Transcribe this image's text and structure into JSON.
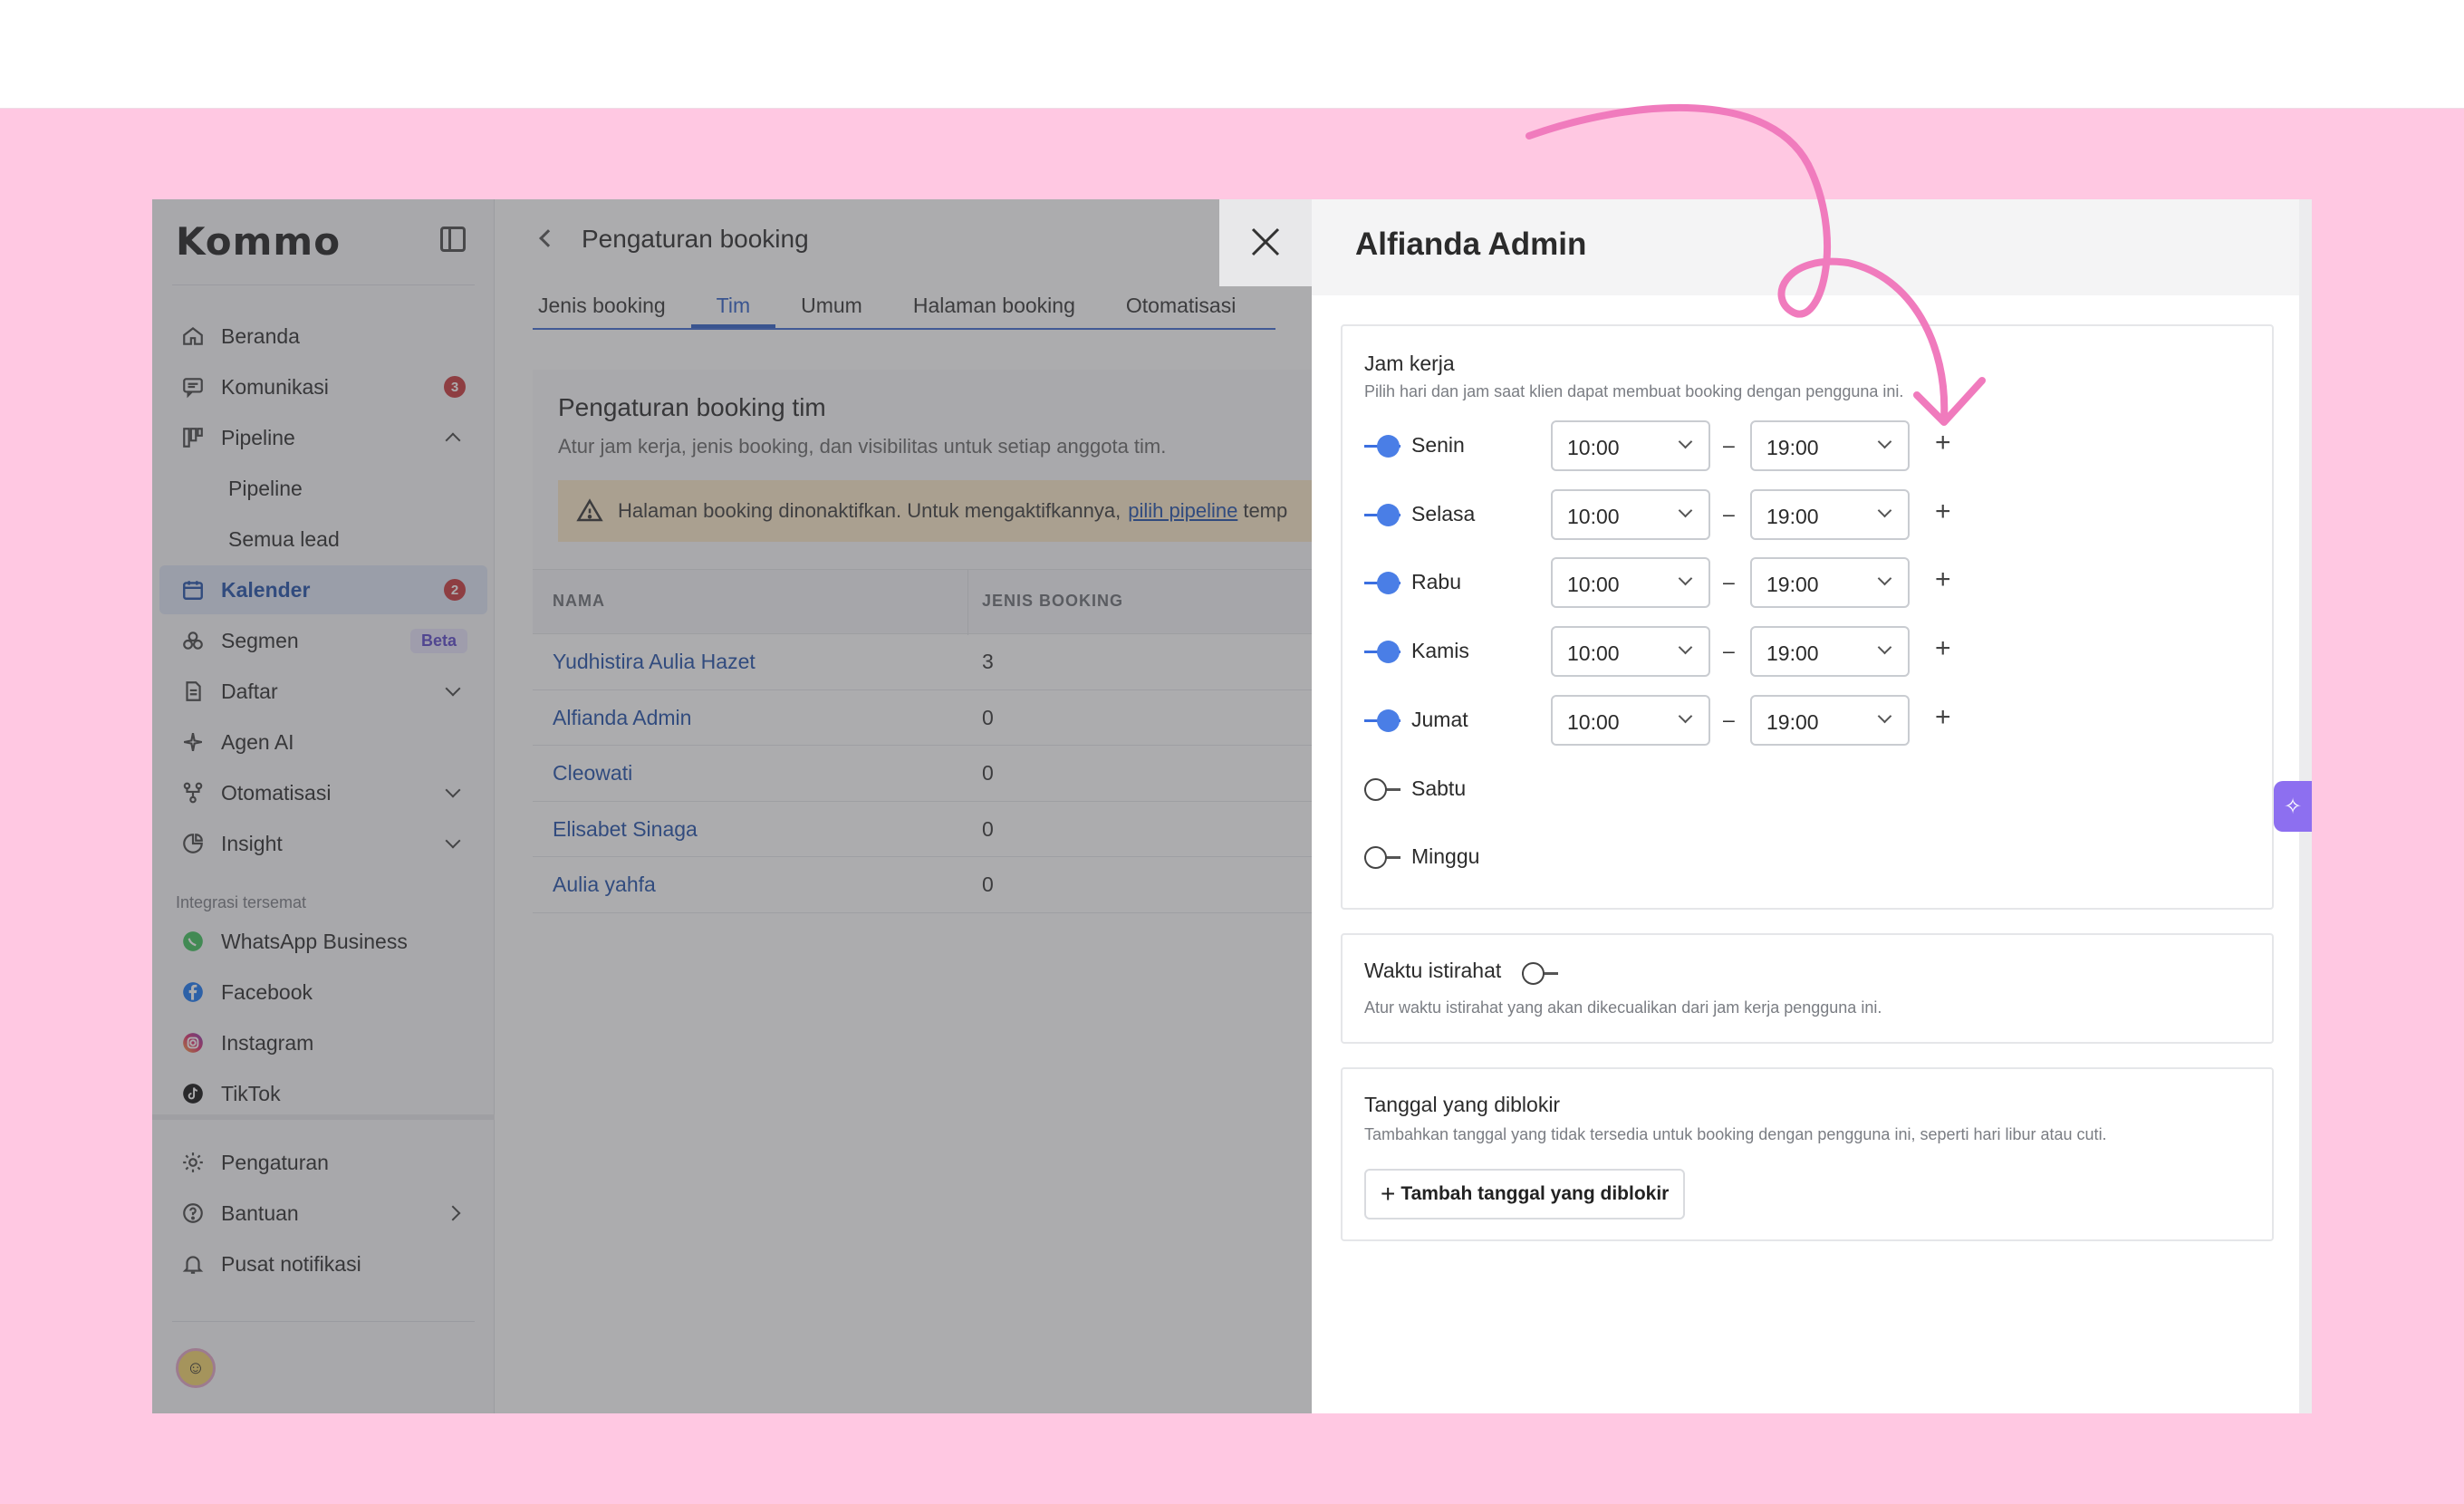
{
  "app": {
    "logo": "Kommo"
  },
  "sidebar": {
    "items": [
      {
        "label": "Beranda",
        "icon": "home-icon"
      },
      {
        "label": "Komunikasi",
        "icon": "chat-icon",
        "badge": "3"
      },
      {
        "label": "Pipeline",
        "icon": "pipeline-icon"
      },
      {
        "label": "Pipeline"
      },
      {
        "label": "Semua lead"
      },
      {
        "label": "Kalender",
        "icon": "calendar-icon",
        "badge": "2"
      },
      {
        "label": "Segmen",
        "icon": "segment-icon",
        "tag": "Beta"
      },
      {
        "label": "Daftar",
        "icon": "list-icon"
      },
      {
        "label": "Agen AI",
        "icon": "sparkle-icon"
      },
      {
        "label": "Otomatisasi",
        "icon": "automation-icon"
      },
      {
        "label": "Insight",
        "icon": "chart-icon"
      }
    ],
    "section_label": "Integrasi tersemat",
    "integrations": [
      {
        "label": "WhatsApp Business"
      },
      {
        "label": "Facebook"
      },
      {
        "label": "Instagram"
      },
      {
        "label": "TikTok"
      }
    ],
    "bottom": [
      {
        "label": "Pengaturan"
      },
      {
        "label": "Bantuan"
      },
      {
        "label": "Pusat notifikasi"
      }
    ]
  },
  "main": {
    "title": "Pengaturan booking",
    "tabs": [
      "Jenis booking",
      "Tim",
      "Umum",
      "Halaman booking",
      "Otomatisasi"
    ],
    "card": {
      "title": "Pengaturan booking tim",
      "desc": "Atur jam kerja, jenis booking, dan visibilitas untuk setiap anggota tim.",
      "warning": "Halaman booking dinonaktifkan. Untuk mengaktifkannya,",
      "warning_link": "pilih pipeline",
      "warning_tail": "temp"
    },
    "table": {
      "headers": [
        "NAMA",
        "JENIS BOOKING"
      ],
      "rows": [
        {
          "name": "Yudhistira Aulia Hazet",
          "value": "3"
        },
        {
          "name": "Alfianda Admin",
          "value": "0"
        },
        {
          "name": "Cleowati",
          "value": "0"
        },
        {
          "name": "Elisabet Sinaga",
          "value": "0"
        },
        {
          "name": "Aulia yahfa",
          "value": "0"
        }
      ]
    }
  },
  "panel": {
    "title": "Alfianda Admin",
    "work_hours": {
      "title": "Jam kerja",
      "desc": "Pilih hari dan jam saat klien dapat membuat booking dengan pengguna ini.",
      "days": [
        {
          "label": "Senin",
          "on": true,
          "start": "10:00",
          "end": "19:00"
        },
        {
          "label": "Selasa",
          "on": true,
          "start": "10:00",
          "end": "19:00"
        },
        {
          "label": "Rabu",
          "on": true,
          "start": "10:00",
          "end": "19:00"
        },
        {
          "label": "Kamis",
          "on": true,
          "start": "10:00",
          "end": "19:00"
        },
        {
          "label": "Jumat",
          "on": true,
          "start": "10:00",
          "end": "19:00"
        },
        {
          "label": "Sabtu",
          "on": false
        },
        {
          "label": "Minggu",
          "on": false
        }
      ],
      "dash": "–",
      "plus": "+"
    },
    "break": {
      "title": "Waktu istirahat",
      "desc": "Atur waktu istirahat yang akan dikecualikan dari jam kerja pengguna ini."
    },
    "blocked": {
      "title": "Tanggal yang diblokir",
      "desc": "Tambahkan tanggal yang tidak tersedia untuk booking dengan pengguna ini, seperti hari libur atau cuti.",
      "button": "Tambah tanggal yang diblokir"
    }
  },
  "colors": {
    "accent": "#2f5fc7",
    "toggle_on": "#4a7ee6",
    "badge": "#c8373b",
    "background": "#ffc8e2",
    "arrow": "#f07bbd"
  }
}
